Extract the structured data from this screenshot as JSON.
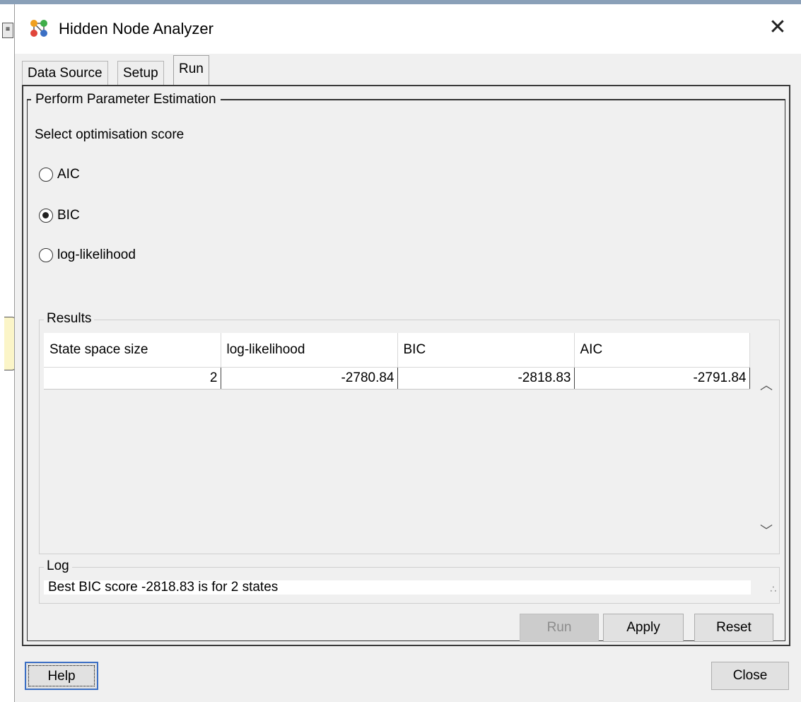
{
  "window": {
    "title": "Hidden Node Analyzer",
    "close_label": "✕"
  },
  "tabs": [
    {
      "label": "Data Source"
    },
    {
      "label": "Setup"
    },
    {
      "label": "Run",
      "active": true
    }
  ],
  "panel": {
    "legend": "Perform Parameter Estimation",
    "score_prompt": "Select optimisation score",
    "score_options": [
      {
        "label": "AIC",
        "checked": false
      },
      {
        "label": "BIC",
        "checked": true
      },
      {
        "label": "log-likelihood",
        "checked": false
      }
    ]
  },
  "results": {
    "legend": "Results",
    "columns": [
      "State space size",
      "log-likelihood",
      "BIC",
      "AIC"
    ],
    "rows": [
      [
        "2",
        "-2780.84",
        "-2818.83",
        "-2791.84"
      ]
    ]
  },
  "log": {
    "legend": "Log",
    "text": "Best BIC score -2818.83 is for 2 states",
    "grip": "∴"
  },
  "buttons": {
    "run": "Run",
    "apply": "Apply",
    "reset": "Reset",
    "help": "Help",
    "close": "Close"
  },
  "colors": {
    "dialog_bg": "#f0f0f0",
    "focus_border": "#3b6fc4"
  }
}
